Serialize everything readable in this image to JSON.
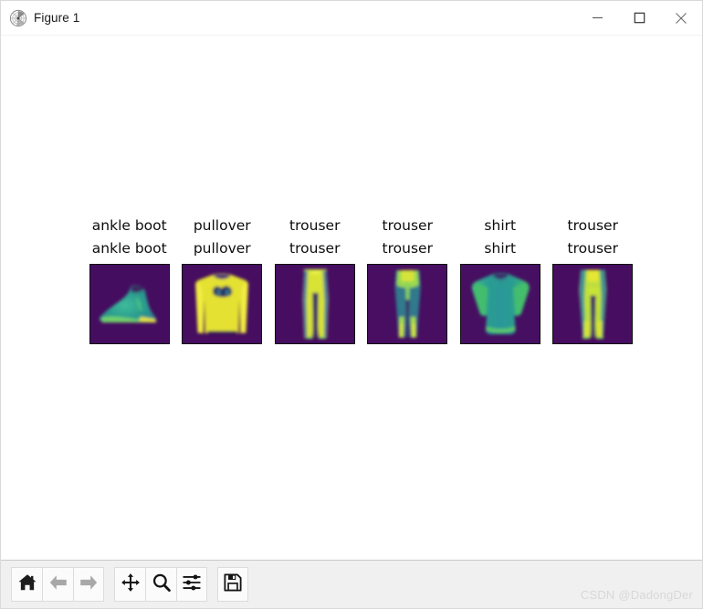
{
  "window": {
    "title": "Figure 1",
    "icon": "matplotlib-logo-icon",
    "minimize_label": "–",
    "maximize_label": "□",
    "close_label": "✕"
  },
  "figure": {
    "background": "#ffffff",
    "colormap": "viridis",
    "cells": [
      {
        "predicted": "ankle boot",
        "actual": "ankle boot",
        "image": "ankle-boot-thumbnail"
      },
      {
        "predicted": "pullover",
        "actual": "pullover",
        "image": "pullover-thumbnail"
      },
      {
        "predicted": "trouser",
        "actual": "trouser",
        "image": "trouser-thumbnail"
      },
      {
        "predicted": "trouser",
        "actual": "trouser",
        "image": "trouser-thumbnail"
      },
      {
        "predicted": "shirt",
        "actual": "shirt",
        "image": "shirt-thumbnail"
      },
      {
        "predicted": "trouser",
        "actual": "trouser",
        "image": "trouser-thumbnail"
      }
    ]
  },
  "toolbar": {
    "buttons": [
      {
        "name": "home-icon",
        "tooltip": "Reset original view"
      },
      {
        "name": "back-arrow-icon",
        "tooltip": "Back to previous view"
      },
      {
        "name": "forward-arrow-icon",
        "tooltip": "Forward to next view"
      },
      {
        "name": "pan-move-icon",
        "tooltip": "Pan axes with left mouse, zoom with right"
      },
      {
        "name": "zoom-magnifier-icon",
        "tooltip": "Zoom to rectangle"
      },
      {
        "name": "configure-subplots-icon",
        "tooltip": "Configure subplots"
      },
      {
        "name": "save-floppy-icon",
        "tooltip": "Save the figure"
      }
    ]
  },
  "watermark": {
    "text": "CSDN @DadongDer",
    "color": "#d8d8d8"
  },
  "colors": {
    "viridis_dark": "#440154",
    "viridis_mid": "#21918c",
    "viridis_green": "#5ec962",
    "viridis_bright": "#fde725",
    "title_text": "#1a1a1a",
    "label_text": "#0d0d0d",
    "toolbar_bg": "#f0f0f0"
  }
}
